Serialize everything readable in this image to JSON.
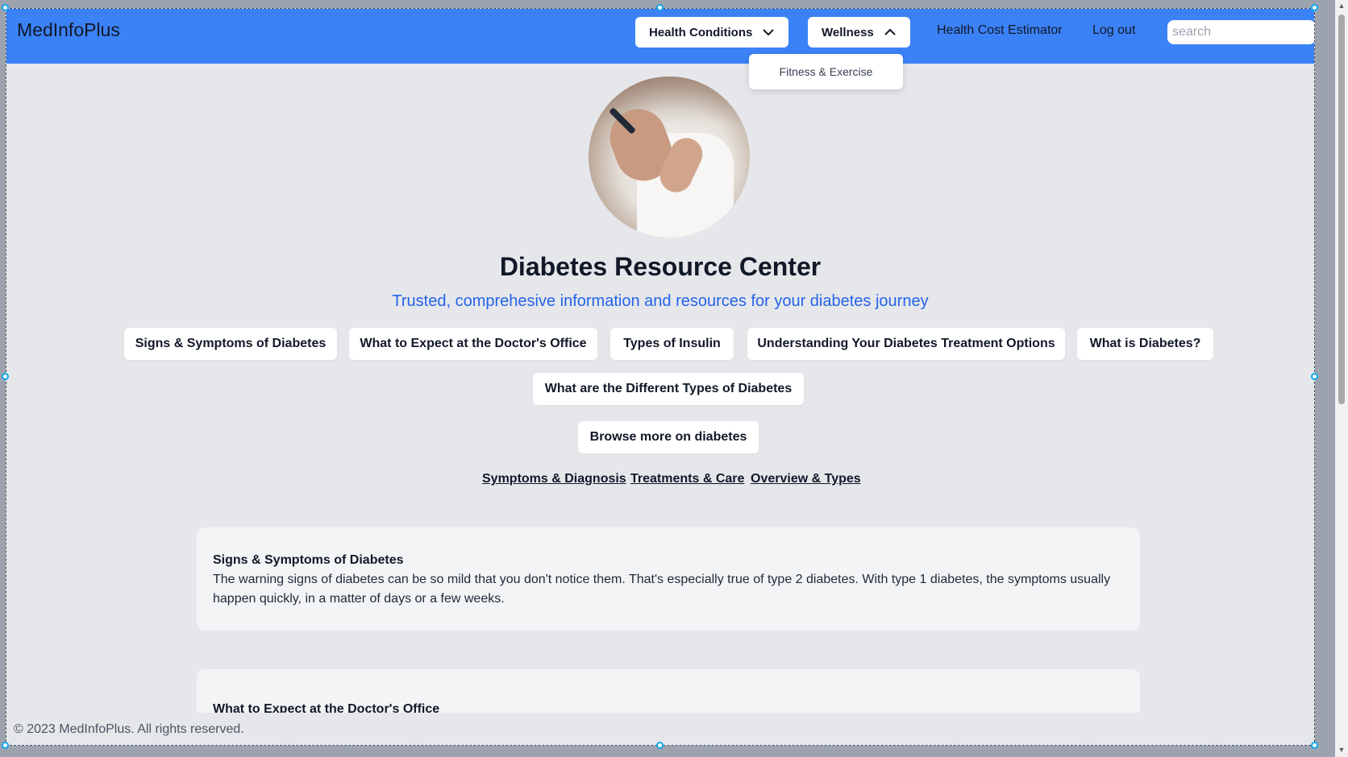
{
  "nav": {
    "logo": "MedInfoPlus",
    "health_conditions": "Health Conditions",
    "wellness": "Wellness",
    "cost_estimator": "Health Cost Estimator",
    "logout": "Log out",
    "search_placeholder": "search"
  },
  "dropdown": {
    "items": [
      {
        "label": "Fitness & Exercise"
      }
    ]
  },
  "hero": {
    "title": "Diabetes Resource Center",
    "subtitle": "Trusted, comprehesive information and resources for your diabetes journey"
  },
  "topics": [
    {
      "label": "Signs & Symptoms of Diabetes"
    },
    {
      "label": "What to Expect at the Doctor's Office"
    },
    {
      "label": "Types of Insulin"
    },
    {
      "label": "Understanding Your Diabetes Treatment Options"
    },
    {
      "label": "What is Diabetes?"
    },
    {
      "label": "What are the Different Types of Diabetes"
    }
  ],
  "browse_more": "Browse more on diabetes",
  "sublinks": [
    {
      "label": "Symptoms & Diagnosis"
    },
    {
      "label": "Treatments & Care"
    },
    {
      "label": "Overview & Types"
    }
  ],
  "articles": [
    {
      "title": "Signs & Symptoms of Diabetes",
      "text": "The warning signs of diabetes can be so mild that you don't notice them. That's especially true of type 2 diabetes. With type 1 diabetes, the symptoms usually happen quickly, in a matter of days or a few weeks."
    },
    {
      "title": "What to Expect at the Doctor's Office",
      "text": ""
    }
  ],
  "footer": "© 2023 MedInfoPlus. All rights reserved.",
  "colors": {
    "navbar": "#3b82f6",
    "subtitle": "#2563eb",
    "page_bg": "#e5e7eb"
  }
}
